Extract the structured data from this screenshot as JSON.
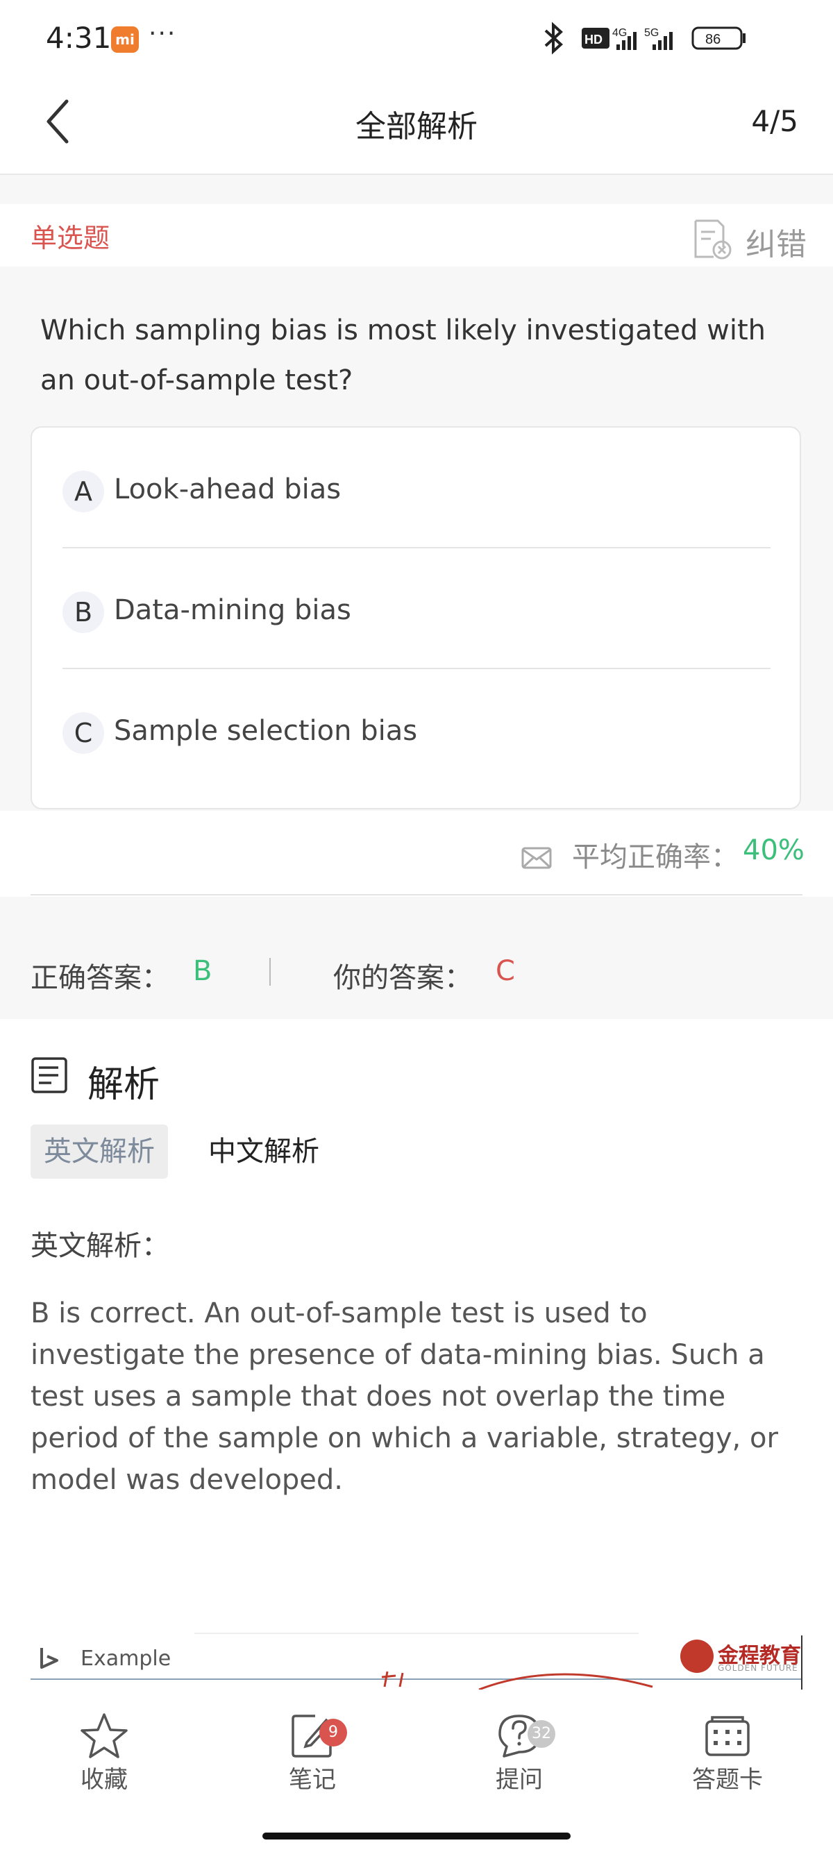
{
  "status_bar": {
    "time": "4:31",
    "mi_badge": "mi",
    "dots": "···",
    "network_hd": "HD",
    "net1": "4G",
    "net2": "5G",
    "battery": "86"
  },
  "nav": {
    "title": "全部解析",
    "page_indicator": "4/5"
  },
  "question": {
    "type_label": "单选题",
    "report_label": "纠错",
    "text": "Which sampling bias is most likely investigated with an out-of-sample test?",
    "options": [
      {
        "letter": "A",
        "text": "Look-ahead bias"
      },
      {
        "letter": "B",
        "text": "Data-mining bias"
      },
      {
        "letter": "C",
        "text": "Sample selection bias"
      }
    ]
  },
  "stats": {
    "accuracy_label": "平均正确率：",
    "accuracy_value": "40%"
  },
  "answers": {
    "correct_label": "正确答案：",
    "correct_value": "B",
    "yours_label": "你的答案：",
    "yours_value": "C"
  },
  "analysis": {
    "title": "解析",
    "tab_en": "英文解析",
    "tab_zh": "中文解析",
    "sub_label": "英文解析：",
    "body": "B is correct. An out-of-sample test is used to investigate the presence of data-mining bias. Such a test uses a sample that does not overlap the time period of the sample on which a variable, strategy, or model was developed."
  },
  "slide": {
    "example_label": "Example",
    "brand_cn": "金程教育",
    "brand_en": "GOLDEN FUTURE"
  },
  "bottom_bar": {
    "items": [
      {
        "label": "收藏",
        "icon": "star-icon",
        "badge": ""
      },
      {
        "label": "笔记",
        "icon": "note-icon",
        "badge": "9"
      },
      {
        "label": "提问",
        "icon": "question-icon",
        "badge": "32"
      },
      {
        "label": "答题卡",
        "icon": "answer-card-icon",
        "badge": ""
      }
    ]
  },
  "colors": {
    "red": "#d9534f",
    "green": "#3bbf7a",
    "gray_bg": "#f7f7f7"
  }
}
